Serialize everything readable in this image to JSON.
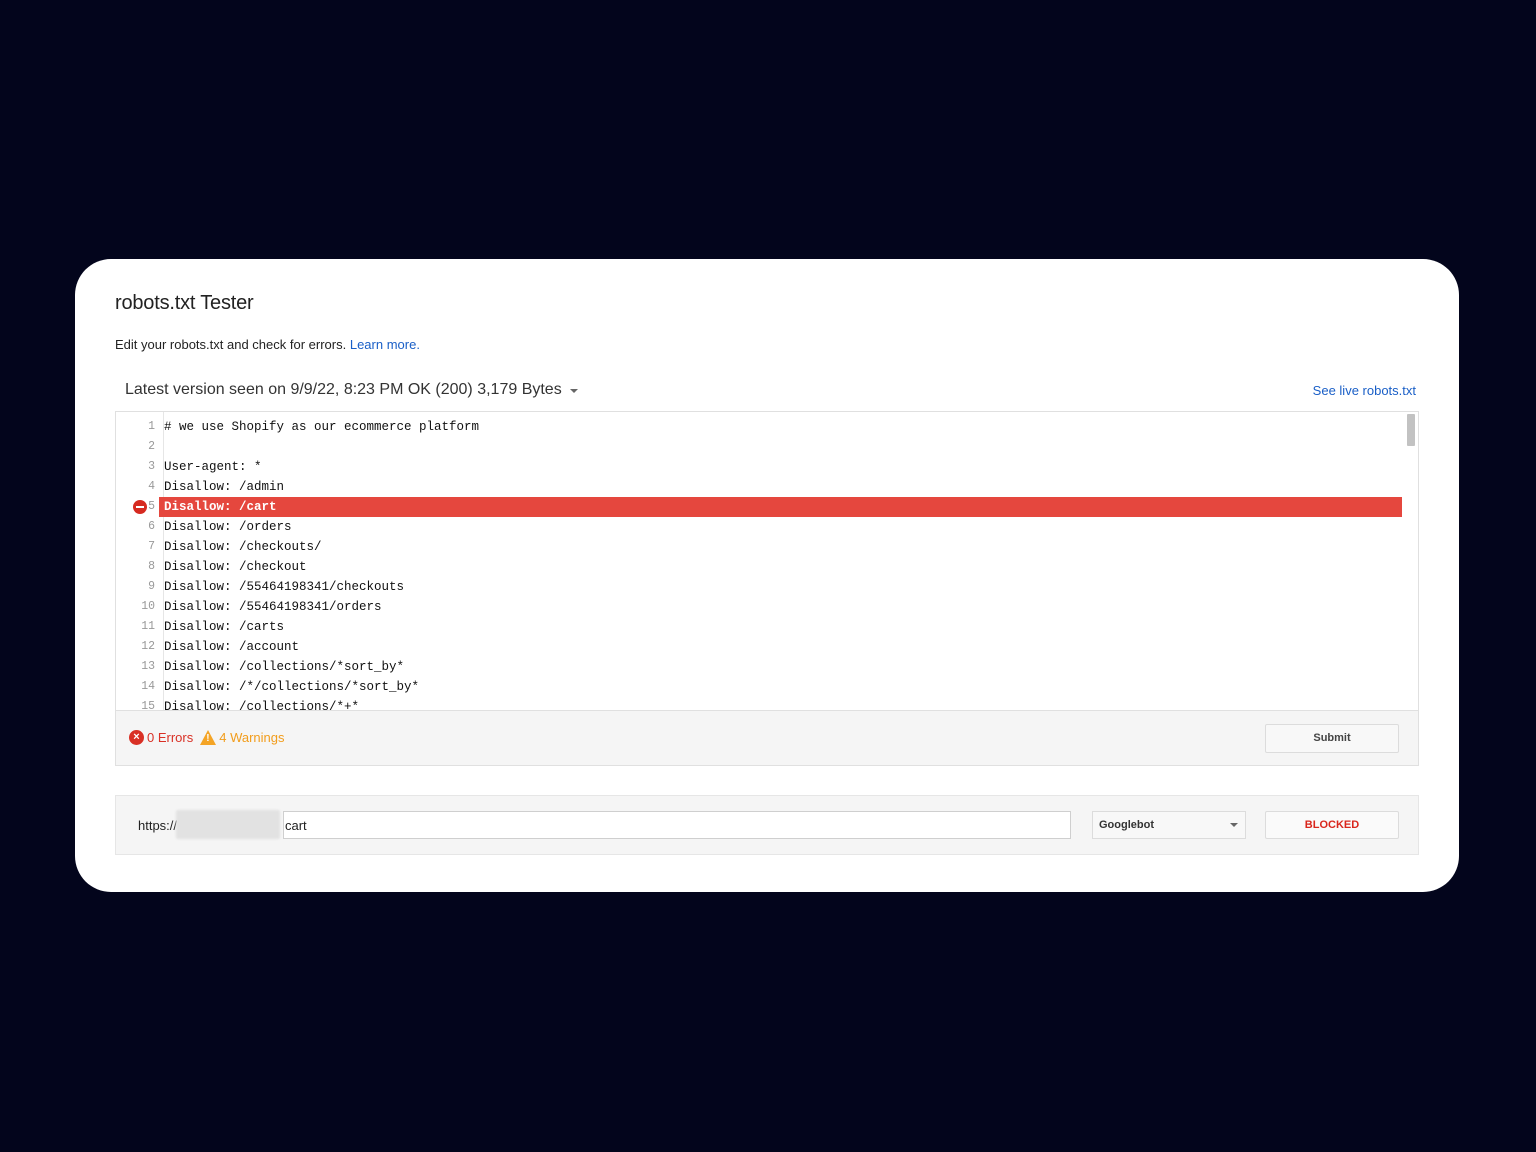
{
  "header": {
    "title": "robots.txt Tester",
    "description": "Edit your robots.txt and check for errors.",
    "learn_more": "Learn more."
  },
  "version": {
    "label": "Latest version seen on 9/9/22, 8:23 PM OK (200) 3,179 Bytes",
    "see_live": "See live robots.txt"
  },
  "editor": {
    "error_line": 5,
    "lines": [
      {
        "n": "1",
        "text": "# we use Shopify as our ecommerce platform"
      },
      {
        "n": "2",
        "text": ""
      },
      {
        "n": "3",
        "text": "User-agent: *"
      },
      {
        "n": "4",
        "text": "Disallow: /admin"
      },
      {
        "n": "5",
        "text": "Disallow: /cart"
      },
      {
        "n": "6",
        "text": "Disallow: /orders"
      },
      {
        "n": "7",
        "text": "Disallow: /checkouts/"
      },
      {
        "n": "8",
        "text": "Disallow: /checkout"
      },
      {
        "n": "9",
        "text": "Disallow: /55464198341/checkouts"
      },
      {
        "n": "10",
        "text": "Disallow: /55464198341/orders"
      },
      {
        "n": "11",
        "text": "Disallow: /carts"
      },
      {
        "n": "12",
        "text": "Disallow: /account"
      },
      {
        "n": "13",
        "text": "Disallow: /collections/*sort_by*"
      },
      {
        "n": "14",
        "text": "Disallow: /*/collections/*sort_by*"
      },
      {
        "n": "15",
        "text": "Disallow: /collections/*+*"
      }
    ]
  },
  "status": {
    "errors": "0 Errors",
    "warnings": "4 Warnings",
    "submit": "Submit"
  },
  "tester": {
    "url_prefix": "https://",
    "url_value": "cart",
    "user_agent": "Googlebot",
    "result": "BLOCKED"
  },
  "colors": {
    "background": "#03051c",
    "error_highlight": "#e5473e",
    "link": "#1a5fc7",
    "blocked": "#d9261c",
    "warning": "#f4a425"
  }
}
